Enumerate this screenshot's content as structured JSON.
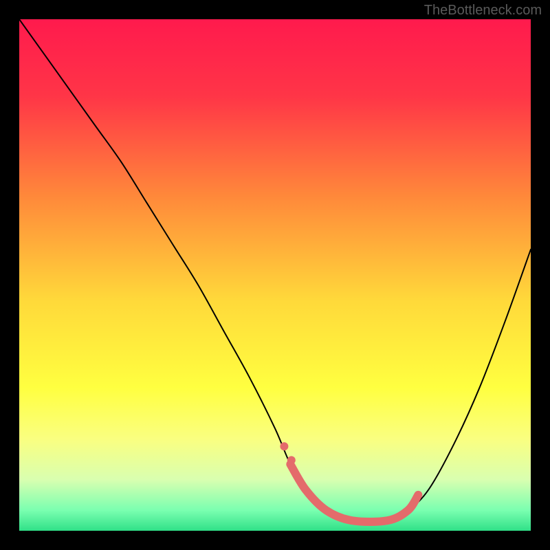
{
  "watermark": "TheBottleneck.com",
  "chart_data": {
    "type": "line",
    "title": "",
    "xlabel": "",
    "ylabel": "",
    "xlim": [
      0,
      100
    ],
    "ylim": [
      0,
      100
    ],
    "background_gradient": {
      "stops": [
        {
          "pos": 0.0,
          "color": "#ff1a4d"
        },
        {
          "pos": 0.15,
          "color": "#ff3547"
        },
        {
          "pos": 0.35,
          "color": "#ff8a3a"
        },
        {
          "pos": 0.55,
          "color": "#ffd93a"
        },
        {
          "pos": 0.72,
          "color": "#ffff40"
        },
        {
          "pos": 0.82,
          "color": "#faff80"
        },
        {
          "pos": 0.9,
          "color": "#d9ffb0"
        },
        {
          "pos": 0.96,
          "color": "#7affb0"
        },
        {
          "pos": 1.0,
          "color": "#30e088"
        }
      ]
    },
    "series": [
      {
        "name": "bottleneck-curve",
        "color": "#000000",
        "width": 2,
        "x": [
          0,
          5,
          10,
          15,
          20,
          25,
          30,
          35,
          40,
          45,
          50,
          53,
          56,
          60,
          65,
          72,
          76,
          80,
          85,
          90,
          95,
          100
        ],
        "y": [
          100,
          93,
          86,
          79,
          72,
          64,
          56,
          48,
          39,
          30,
          20,
          13,
          8,
          4,
          2,
          2,
          4,
          8,
          17,
          28,
          41,
          55
        ]
      },
      {
        "name": "highlight-segment",
        "color": "#e46b6b",
        "width": 12,
        "style": "round-markers",
        "x": [
          53,
          56,
          60,
          65,
          72,
          76,
          78
        ],
        "y": [
          13,
          8,
          4,
          2,
          2,
          4,
          7
        ]
      }
    ]
  }
}
